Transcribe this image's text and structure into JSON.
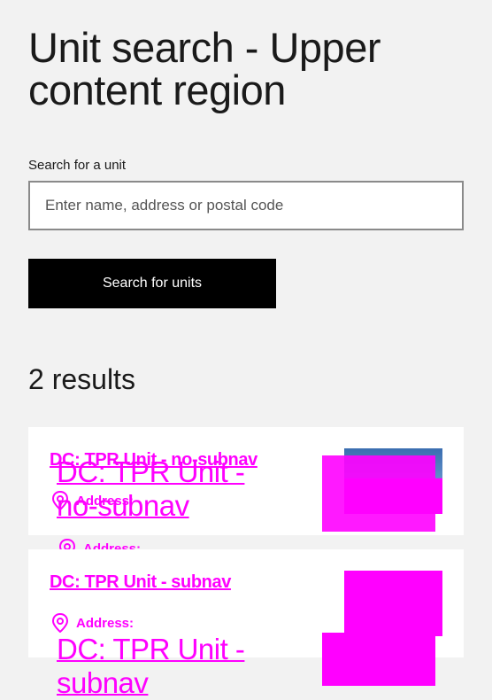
{
  "page": {
    "title": "Unit search - Upper content region"
  },
  "search": {
    "label": "Search for a unit",
    "placeholder": "Enter name, address or postal code",
    "button_label": "Search for units"
  },
  "results": {
    "count_text": "2 results",
    "items": [
      {
        "name": "DC: TPR Unit - no-subnav",
        "address_label": "Address:"
      },
      {
        "name": "DC: TPR Unit - subnav",
        "address_label": "Address:"
      }
    ]
  },
  "colors": {
    "background": "#f2f2f2",
    "card": "#ffffff",
    "button": "#000000",
    "accent": "#ff00ff"
  },
  "icons": {
    "address": "location-pin-icon"
  }
}
